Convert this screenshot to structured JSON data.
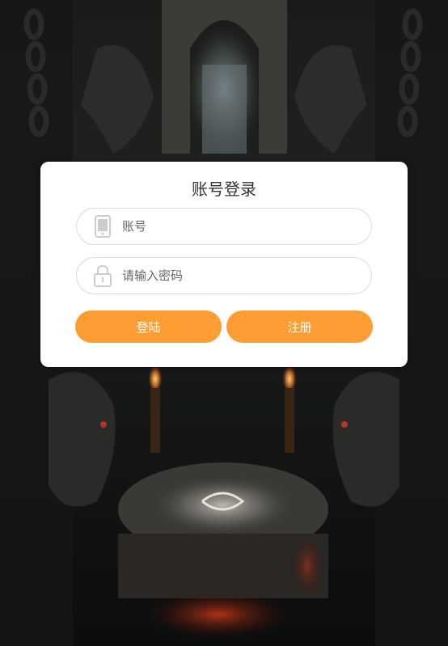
{
  "login": {
    "title": "账号登录",
    "account_placeholder": "账号",
    "password_placeholder": "请输入密码",
    "login_label": "登陆",
    "register_label": "注册"
  },
  "icons": {
    "account": "phone-icon",
    "password": "lock-icon"
  },
  "colors": {
    "accent": "#ff9d35",
    "card_background": "#ffffff",
    "title_text": "#333333",
    "placeholder_text": "#666666",
    "field_border": "#dddddd",
    "icon_gray": "#cccccc"
  }
}
